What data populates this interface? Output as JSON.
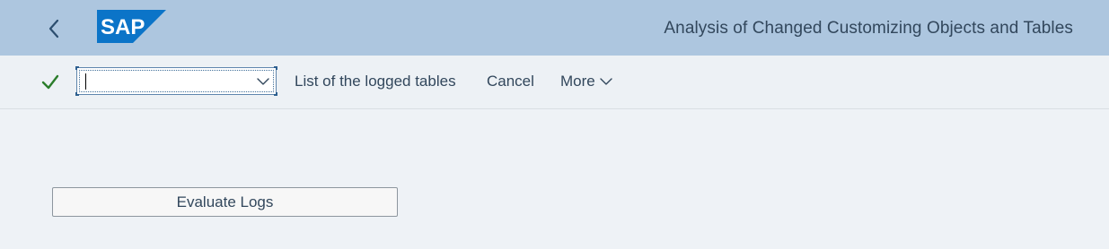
{
  "header": {
    "back_icon": "chevron-left-icon",
    "logo_text": "SAP",
    "title": "Analysis of Changed Customizing Objects and Tables",
    "colors": {
      "bar": "#adc6df",
      "logo": "#0b74c8"
    }
  },
  "toolbar": {
    "confirm_icon": "checkmark-icon",
    "command_field": {
      "value": "",
      "placeholder": ""
    },
    "buttons": {
      "logged_tables": "List of the logged tables",
      "cancel": "Cancel",
      "more": "More"
    }
  },
  "content": {
    "evaluate_button": "Evaluate Logs"
  }
}
